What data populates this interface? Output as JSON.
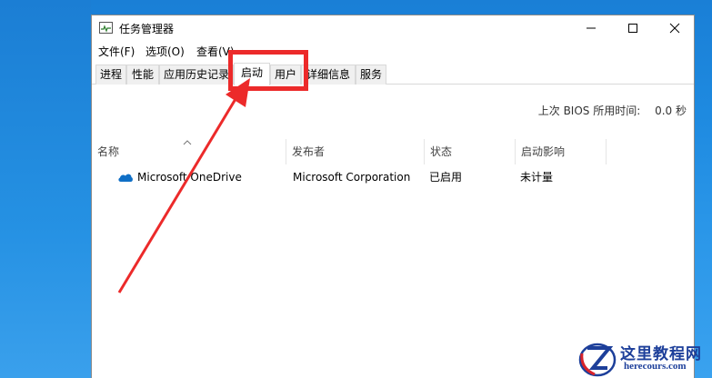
{
  "window": {
    "title": "任务管理器",
    "icon": "task-manager-icon"
  },
  "menu": {
    "items": [
      {
        "label": "文件(F)"
      },
      {
        "label": "选项(O)"
      },
      {
        "label": "查看(V)"
      }
    ]
  },
  "tabs": [
    {
      "label": "进程"
    },
    {
      "label": "性能"
    },
    {
      "label": "应用历史记录"
    },
    {
      "label": "启动",
      "active": true
    },
    {
      "label": "用户"
    },
    {
      "label": "详细信息"
    },
    {
      "label": "服务"
    }
  ],
  "bios": {
    "label": "上次 BIOS 所用时间:",
    "value": "0.0 秒"
  },
  "table": {
    "columns": [
      "名称",
      "发布者",
      "状态",
      "启动影响"
    ],
    "rows": [
      {
        "name": "Microsoft OneDrive",
        "publisher": "Microsoft Corporation",
        "status": "已启用",
        "impact": "未计量",
        "icon": "onedrive-cloud-icon"
      }
    ]
  },
  "watermark": {
    "title": "这里教程网",
    "subtitle": "herecours.com"
  },
  "colors": {
    "highlight": "#ec2a2a",
    "desktop": "#1e8ae0",
    "onedrive": "#0f6fc6",
    "watermark": "#1d3f9a"
  }
}
